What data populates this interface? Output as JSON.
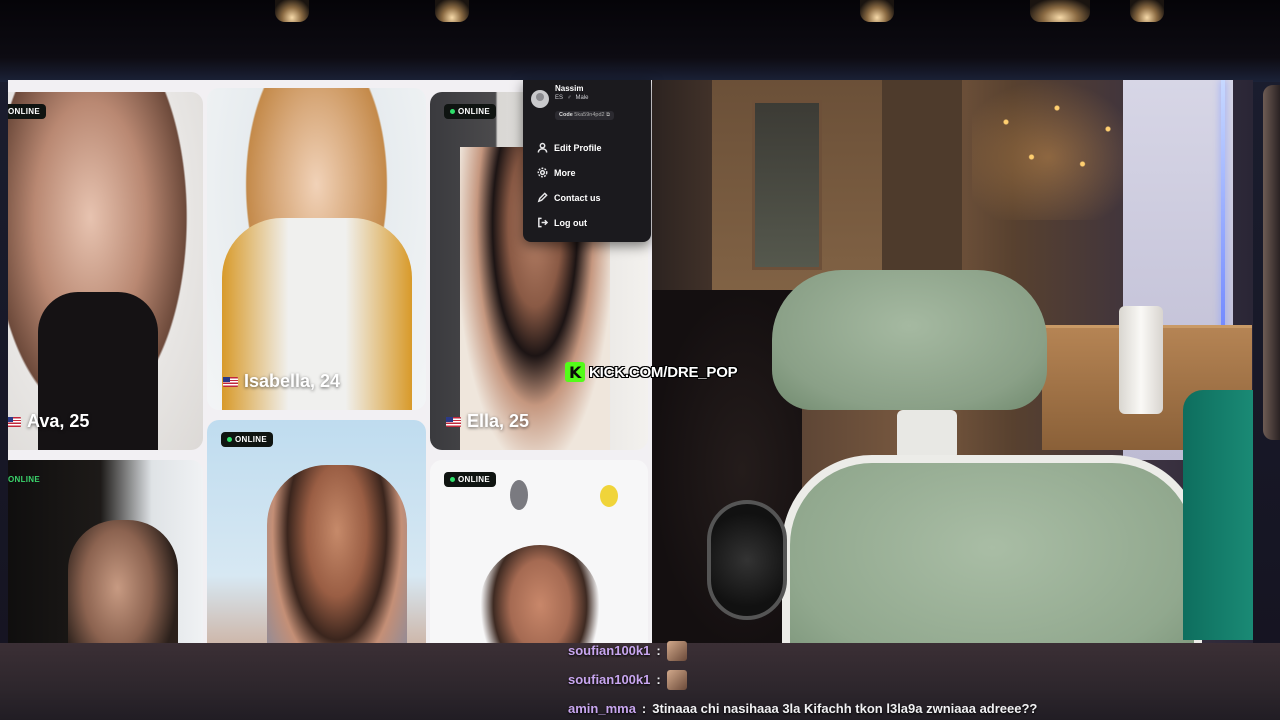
{
  "profiles": [
    {
      "name": "Ava, 25",
      "badge": "ONLINE",
      "flag": true
    },
    {
      "name": "Isabella, 24",
      "badge": "",
      "flag": true
    },
    {
      "name": "Ella, 25",
      "badge": "ONLINE",
      "flag": true
    },
    {
      "name": "",
      "badge": "ONLINE",
      "flag": false
    },
    {
      "name": "",
      "badge": "ONLINE",
      "flag": false
    },
    {
      "name": "",
      "badge": "ONLINE",
      "flag": false
    }
  ],
  "menu": {
    "username": "Nassim",
    "country": "ES",
    "gender": "Male",
    "code_label": "Code",
    "code_value": "5ka59n4pd2",
    "items": [
      "Edit Profile",
      "More",
      "Contact us",
      "Log out"
    ]
  },
  "overlay": {
    "kick_text": "KICK.COM/DRE_POP"
  },
  "chat": [
    {
      "user": "soufian100k1",
      "message": ""
    },
    {
      "user": "soufian100k1",
      "message": ""
    },
    {
      "user": "amin_mma",
      "message": "3tinaaa chi nasihaaa 3la Kifachh tkon l3la9a zwniaaa adreee??"
    }
  ],
  "colors": {
    "online_dot": "#2ee06a",
    "kick_green": "#53fc18",
    "chat_username": "#c8a6ef"
  }
}
